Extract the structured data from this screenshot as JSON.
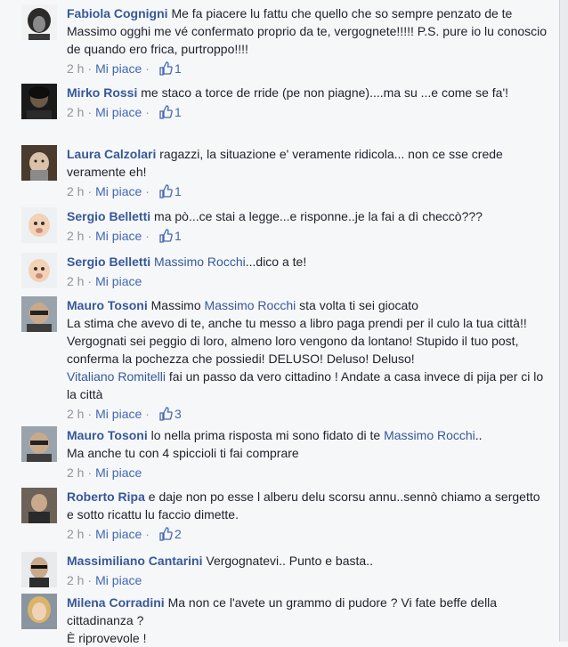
{
  "comments": [
    {
      "author": "Fabiola Cognigni",
      "text": "Me fa piacere lu fattu che quello che so sempre penzato de te Massimo ogghi me vé confermato proprio da te, vergognete!!!!! P.S. pure io lu conoscio de quando ero frica, purtroppo!!!!",
      "time": "2 h",
      "like_label": "Mi piace",
      "likes": "1"
    },
    {
      "author": "Mirko Rossi",
      "text": "me staco a torce de rride (pe non piagne)....ma su ...e come se fa'!",
      "time": "2 h",
      "like_label": "Mi piace",
      "likes": "1"
    },
    {
      "author": "Laura Calzolari",
      "text": "ragazzi, la situazione e' veramente ridicola... non ce sse crede veramente eh!",
      "time": "2 h",
      "like_label": "Mi piace",
      "likes": "1"
    },
    {
      "author": "Sergio Belletti",
      "text": "ma pò...ce stai a legge...e risponne..je la fai a dì checcò???",
      "time": "2 h",
      "like_label": "Mi piace",
      "likes": "1"
    },
    {
      "author": "Sergio Belletti",
      "mention": "Massimo Rocchi",
      "text": "...dico a te!",
      "time": "2 h",
      "like_label": "Mi piace"
    },
    {
      "author": "Mauro Tosoni",
      "text_pre": "Massimo",
      "mention": "Massimo Rocchi",
      "text": "sta volta ti sei giocato",
      "text_2": "La stima che avevo di te, anche tu messo a libro paga prendi per il culo la tua città!! Vergognati sei peggio di loro, almeno loro vengono da lontano! Stupido il tuo post, conferma la pochezza che possiedi! DELUSO! Deluso! Deluso!",
      "mention_2": "Vitaliano Romitelli",
      "text_3": "fai un passo da vero cittadino ! Andate a casa invece di pija per ci lo la città",
      "time": "2 h",
      "like_label": "Mi piace",
      "likes": "3"
    },
    {
      "author": "Mauro Tosoni",
      "text": "lo nella prima risposta mi sono fidato di te",
      "mention": "Massimo Rocchi",
      "text_post": "..",
      "text_2": "Ma anche tu con 4 spiccioli ti fai comprare",
      "time": "2 h",
      "like_label": "Mi piace"
    },
    {
      "author": "Roberto Ripa",
      "text": "e daje non po esse l alberu delu scorsu annu..sennò chiamo a sergetto e sotto ricattu lu faccio dimette.",
      "time": "2 h",
      "like_label": "Mi piace",
      "likes": "2"
    },
    {
      "author": "Massimiliano Cantarini",
      "text": "Vergognatevi.. Punto e basta..",
      "time": "2 h",
      "like_label": "Mi piace"
    },
    {
      "author": "Milena Corradini",
      "text": "Ma non ce l'avete un grammo di pudore ? Vi fate beffe della cittadinanza ?",
      "text_2": "È riprovevole !"
    }
  ],
  "colors": {
    "link": "#365899",
    "like": "#4267b2",
    "meta": "#90949c",
    "background": "#f6f7f9"
  },
  "icons": {
    "like_count": "thumbs-up-icon"
  }
}
